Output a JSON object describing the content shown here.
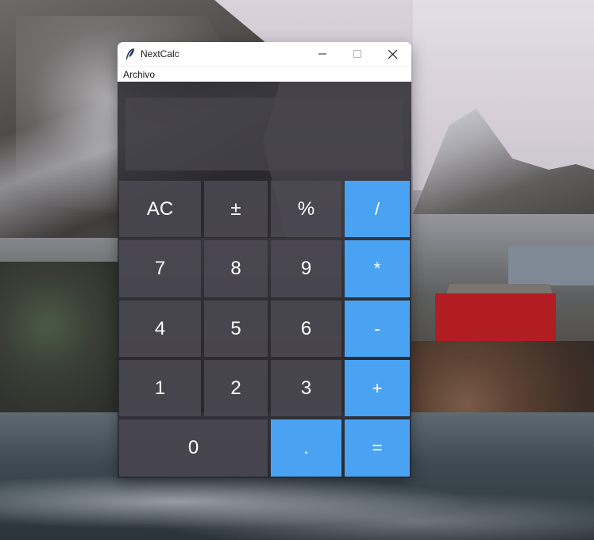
{
  "window": {
    "title": "NextCalc"
  },
  "menu": {
    "items": [
      "Archivo"
    ]
  },
  "display": {
    "value": ""
  },
  "keys": {
    "ac": "AC",
    "sign": "±",
    "percent": "%",
    "divide": "/",
    "seven": "7",
    "eight": "8",
    "nine": "9",
    "multiply": "*",
    "four": "4",
    "five": "5",
    "six": "6",
    "minus": "-",
    "one": "1",
    "two": "2",
    "three": "3",
    "plus": "+",
    "zero": "0",
    "decimal": ".",
    "equals": "="
  },
  "colors": {
    "operator_key": "#4aa3f2",
    "number_key": "#4e4c56",
    "display_bg": "#48464e",
    "titlebar": "#ffffff"
  },
  "icons": {
    "app": "feather-icon",
    "minimize": "minimize-icon",
    "maximize": "maximize-icon",
    "close": "close-icon"
  }
}
